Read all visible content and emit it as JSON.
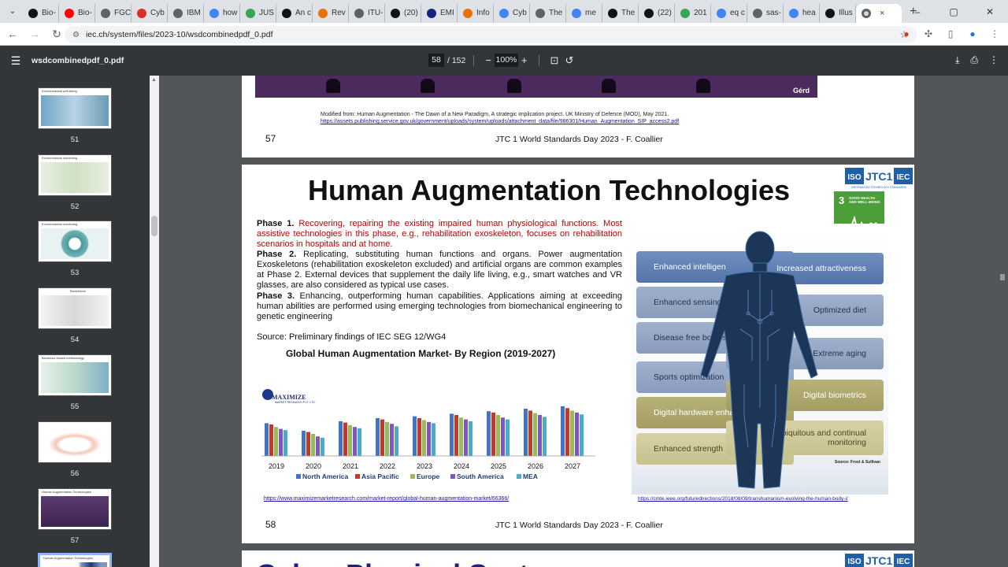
{
  "tabs": [
    {
      "label": "Bio-",
      "icon": "bio-tab-icon",
      "color": "#111111"
    },
    {
      "label": "Bio-",
      "icon": "youtube-icon",
      "color": "#ff0000"
    },
    {
      "label": "FGC",
      "icon": "globe-icon",
      "color": "#5f6368"
    },
    {
      "label": "Cyb",
      "icon": "pdf-icon",
      "color": "#d93025"
    },
    {
      "label": "IBM",
      "icon": "page-icon",
      "color": "#5f6368"
    },
    {
      "label": "how",
      "icon": "google-icon",
      "color": "#4285f4"
    },
    {
      "label": "JUS",
      "icon": "play-icon",
      "color": "#34a853"
    },
    {
      "label": "An c",
      "icon": "bio-tab-icon",
      "color": "#111111"
    },
    {
      "label": "Rev",
      "icon": "e-icon",
      "color": "#e8710a"
    },
    {
      "label": "ITU-",
      "icon": "globe-icon",
      "color": "#5f6368"
    },
    {
      "label": "(20)",
      "icon": "x-icon",
      "color": "#111111"
    },
    {
      "label": "EMI",
      "icon": "doc-icon",
      "color": "#1a237e"
    },
    {
      "label": "Info",
      "icon": "puzzle-icon",
      "color": "#e8710a"
    },
    {
      "label": "Cyb",
      "icon": "google-icon",
      "color": "#4285f4"
    },
    {
      "label": "The",
      "icon": "globe-icon",
      "color": "#5f6368"
    },
    {
      "label": "me",
      "icon": "google-icon",
      "color": "#4285f4"
    },
    {
      "label": "The",
      "icon": "x-icon",
      "color": "#111111"
    },
    {
      "label": "(22)",
      "icon": "x-icon",
      "color": "#111111"
    },
    {
      "label": "201",
      "icon": "play-icon",
      "color": "#34a853"
    },
    {
      "label": "eq c",
      "icon": "google-icon",
      "color": "#4285f4"
    },
    {
      "label": "sas-",
      "icon": "globe-icon",
      "color": "#5f6368"
    },
    {
      "label": "hea",
      "icon": "google-icon",
      "color": "#4285f4"
    },
    {
      "label": "Illus",
      "icon": "r-icon",
      "color": "#111111"
    }
  ],
  "active_tab": {
    "label": "",
    "close": "×"
  },
  "new_tab": "+",
  "window_controls": {
    "minimize": "–",
    "maximize": "▢",
    "close": "✕"
  },
  "url": "iec.ch/system/files/2023-10/wsdcombinedpdf_0.pdf",
  "pdf": {
    "filename": "wsdcombinedpdf_0.pdf",
    "current_page": "58",
    "total_pages": "/ 152",
    "zoom": "100%"
  },
  "thumbnails": [
    {
      "num": "51",
      "title": "Environmental well-being"
    },
    {
      "num": "52",
      "title": "Environmental monitoring"
    },
    {
      "num": "53",
      "title": "Environmental monitoring"
    },
    {
      "num": "54",
      "title": "Biosensors"
    },
    {
      "num": "55",
      "title": "Biosensor-based methodology"
    },
    {
      "num": "56",
      "title": ""
    },
    {
      "num": "57",
      "title": "Human Augmentation Technologies"
    },
    {
      "num": "",
      "title": "Human Augmentation Technologies"
    }
  ],
  "page57": {
    "credit": "Gérd",
    "modified": "Modified from: Human Augmentation - The Dawn of a New Paradigm, A strategic implication project. UK Ministry of Defence (MOD), May 2021.",
    "link": "https://assets.publishing.service.gov.uk/government/uploads/system/uploads/attachment_data/file/986301/Human_Augmentation_SIP_access2.pdf",
    "page_number": "57",
    "footer": "JTC 1 World Standards Day 2023 - F. Coallier"
  },
  "page58": {
    "title": "Human Augmentation Technologies",
    "logo": {
      "iso": "ISO",
      "jtc": "JTC1",
      "iec": "IEC",
      "sub": "INFORMATION TECHNOLOGY STANDARDS"
    },
    "sdg": {
      "number": "3",
      "text": "GOOD HEALTH AND WELL-BEING"
    },
    "phase1_label": "Phase 1.",
    "phase1_text": "Recovering, repairing the existing impaired human physiological functions. Most assistive technologies in this phase, e.g., rehabilitation exoskeleton, focuses on rehabilitation scenarios in hospitals and at home.",
    "phase2_label": "Phase 2.",
    "phase2_text": "Replicating, substituting human functions and organs. Power augmentation Exoskeletons (rehabilitation exoskeleton excluded) and artificial organs are common examples at Phase 2. External devices that supplement the daily life living, e.g., smart watches and VR glasses, are also considered as typical use cases.",
    "phase3_label": "Phase 3.",
    "phase3_text": "Enhancing, outperforming human capabilities. Applications aiming at exceeding human abilities are performed using emerging technologies from biomechanical engineering to genetic engineering",
    "source": "Source: Preliminary findings of IEC SEG 12/WG4",
    "chart_link": "https://www.maximizemarketresearch.com/market-report/global-human-augmentation-market/66366/",
    "body_link": "https://cmte.ieee.org/futuredirections/2018/08/09/transhumanism-evolving-the-human-body-i/",
    "maximize": {
      "name": "MAXIMIZE",
      "sub": "MARKET RESEARCH PVT. LTD."
    },
    "body_bands_left": [
      "Enhanced intelligence",
      "Enhanced sensing",
      "Disease free bodies",
      "Sports optimization",
      "Digital hardware enhancements",
      "Enhanced strength"
    ],
    "body_bands_right": [
      "Increased attractiveness",
      "Optimized diet",
      "Extreme aging",
      "Digital biometrics",
      "Ubiquitous and continual monitoring"
    ],
    "body_source": "Source: Frost & Sullivan",
    "page_number": "58",
    "footer": "JTC 1 World Standards Day 2023 - F. Coallier"
  },
  "page59": {
    "title": "Cyber-Physical Syst"
  },
  "chart_data": {
    "type": "bar",
    "title": "Global Human Augmentation Market- By Region (2019-2027)",
    "categories": [
      "2019",
      "2020",
      "2021",
      "2022",
      "2023",
      "2024",
      "2025",
      "2026",
      "2027"
    ],
    "series": [
      {
        "name": "North America",
        "color": "#4472c4",
        "values": [
          52,
          40,
          55,
          60,
          63,
          67,
          71,
          75,
          79
        ]
      },
      {
        "name": "Asia Pacific",
        "color": "#c0392b",
        "values": [
          50,
          38,
          53,
          58,
          60,
          65,
          69,
          72,
          76
        ]
      },
      {
        "name": "Europe",
        "color": "#9bbb59",
        "values": [
          46,
          35,
          49,
          54,
          57,
          61,
          65,
          68,
          72
        ]
      },
      {
        "name": "South America",
        "color": "#7e57c2",
        "values": [
          43,
          31,
          46,
          51,
          54,
          58,
          61,
          65,
          69
        ]
      },
      {
        "name": "MEA",
        "color": "#4bacc6",
        "values": [
          41,
          29,
          44,
          47,
          52,
          55,
          58,
          62,
          66
        ]
      }
    ],
    "ylim": [
      0,
      100
    ],
    "grid": false,
    "legend": "bottom"
  }
}
